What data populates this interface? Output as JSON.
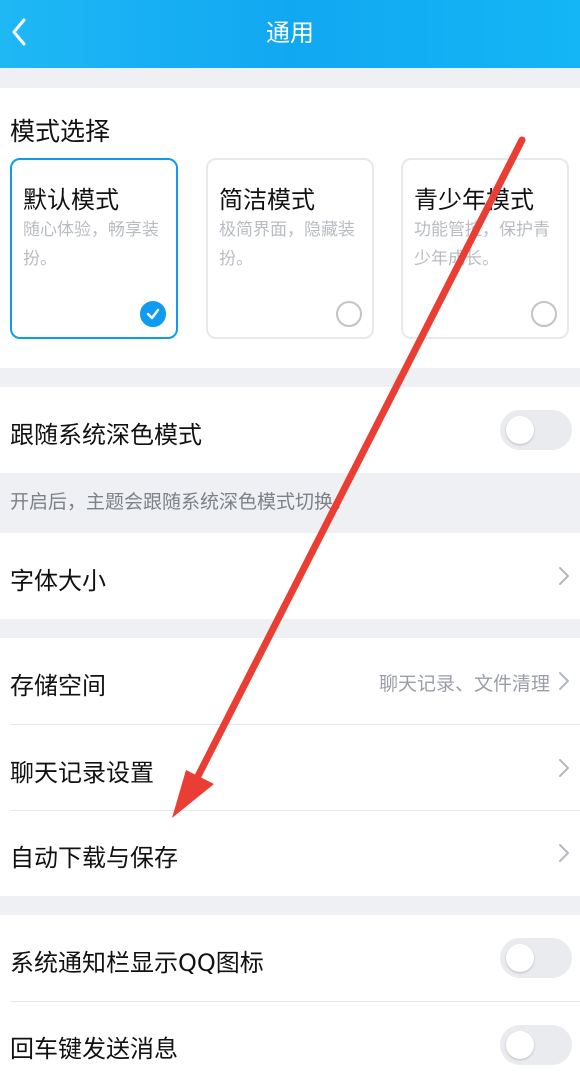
{
  "header": {
    "title": "通用"
  },
  "mode_section": {
    "title": "模式选择",
    "cards": [
      {
        "title": "默认模式",
        "desc": "随心体验，畅享装扮。",
        "selected": true
      },
      {
        "title": "简洁模式",
        "desc": "极简界面，隐藏装扮。",
        "selected": false
      },
      {
        "title": "青少年模式",
        "desc": "功能管控，保护青少年成长。",
        "selected": false
      }
    ]
  },
  "dark_mode": {
    "label": "跟随系统深色模式",
    "enabled": false,
    "hint": "开启后，主题会跟随系统深色模式切换。"
  },
  "font_size": {
    "label": "字体大小"
  },
  "storage": {
    "label": "存储空间",
    "value": "聊天记录、文件清理"
  },
  "chat_history": {
    "label": "聊天记录设置"
  },
  "auto_download": {
    "label": "自动下载与保存"
  },
  "notification_icon": {
    "label": "系统通知栏显示QQ图标",
    "enabled": false
  },
  "enter_send": {
    "label": "回车键发送消息",
    "enabled": false
  },
  "colors": {
    "accent": "#0e9bf0",
    "header": "#11a8f2",
    "annotation_arrow": "#ea3d33"
  }
}
